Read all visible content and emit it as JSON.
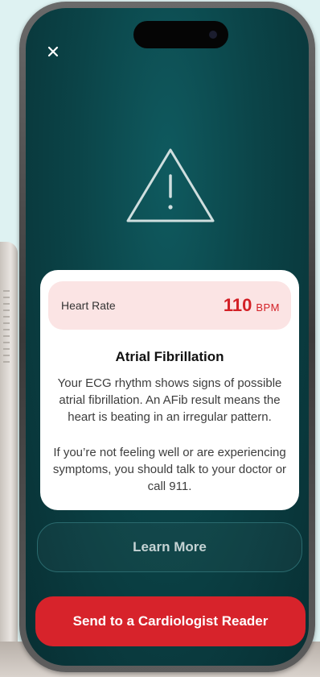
{
  "heart_rate": {
    "label": "Heart Rate",
    "value": "110",
    "unit": "BPM"
  },
  "result": {
    "title": "Atrial Fibrillation",
    "description": "Your ECG rhythm shows signs of possible atrial fibrillation. An AFib result means the heart is beating in an irregular pattern.",
    "advice": "If you’re not feeling well or are experiencing symptoms, you should talk to your doctor or call 911."
  },
  "actions": {
    "learn_more": "Learn More",
    "send": "Send to a Cardiologist Reader"
  },
  "icons": {
    "close": "close-icon",
    "warning": "warning-triangle-icon"
  },
  "colors": {
    "background": "#0b4448",
    "accent_red": "#d7232b",
    "heart_rate_red": "#d32026",
    "heart_rate_bg": "#fbe4e4"
  }
}
